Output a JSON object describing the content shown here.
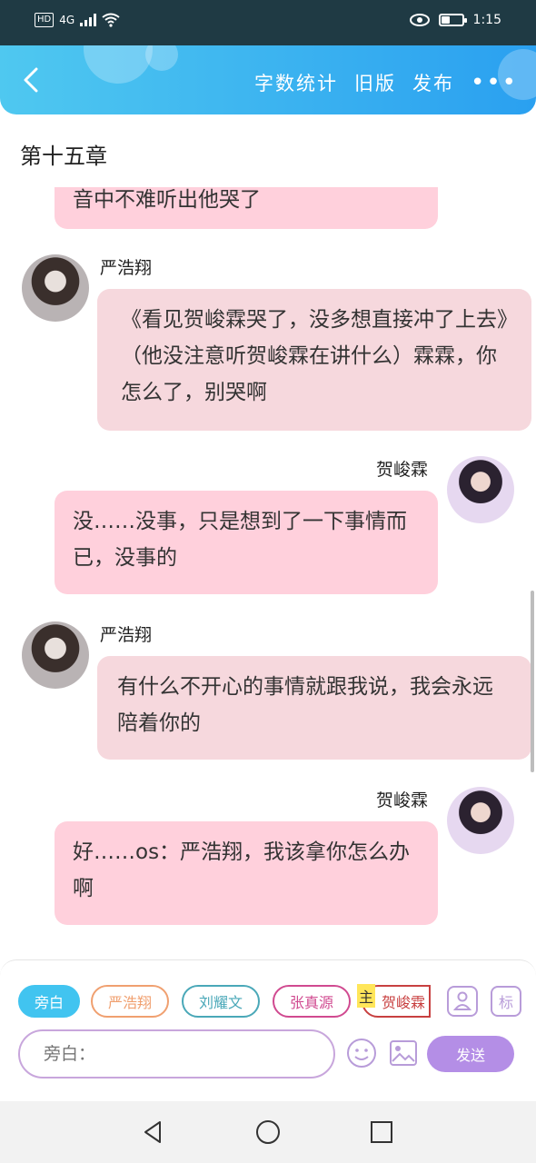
{
  "status_bar": {
    "left_badges": [
      "HD",
      "4G"
    ],
    "time": "1:15"
  },
  "header": {
    "actions": [
      "字数统计",
      "旧版",
      "发布"
    ],
    "more_label": "•••",
    "back_icon": "chevron-left-icon"
  },
  "chapter": {
    "title": "第十五章"
  },
  "messages": [
    {
      "side": "left",
      "text": "音中不难听出他哭了"
    },
    {
      "side": "left",
      "name": "严浩翔",
      "text": "《看见贺峻霖哭了，没多想直接冲了上去》（他没注意听贺峻霖在讲什么）霖霖，你怎么了，别哭啊"
    },
    {
      "side": "right",
      "name": "贺峻霖",
      "text": "没……没事，只是想到了一下事情而已，没事的"
    },
    {
      "side": "left",
      "name": "严浩翔",
      "text": "有什么不开心的事情就跟我说，我会永远陪着你的"
    },
    {
      "side": "right",
      "name": "贺峻霖",
      "text": "好……os：严浩翔，我该拿你怎么办啊"
    }
  ],
  "roles": {
    "chips": [
      "旁白",
      "严浩翔",
      "刘耀文",
      "张真源",
      "贺峻霖"
    ],
    "main_tag": "主",
    "chip_colors": [
      "#41c4f0",
      "#f0a070",
      "#4aa8b8",
      "#d04a90",
      "#c84040"
    ],
    "side_icons": [
      "person-icon",
      "标"
    ]
  },
  "composer": {
    "placeholder": "旁白：",
    "send_label": "发送"
  }
}
